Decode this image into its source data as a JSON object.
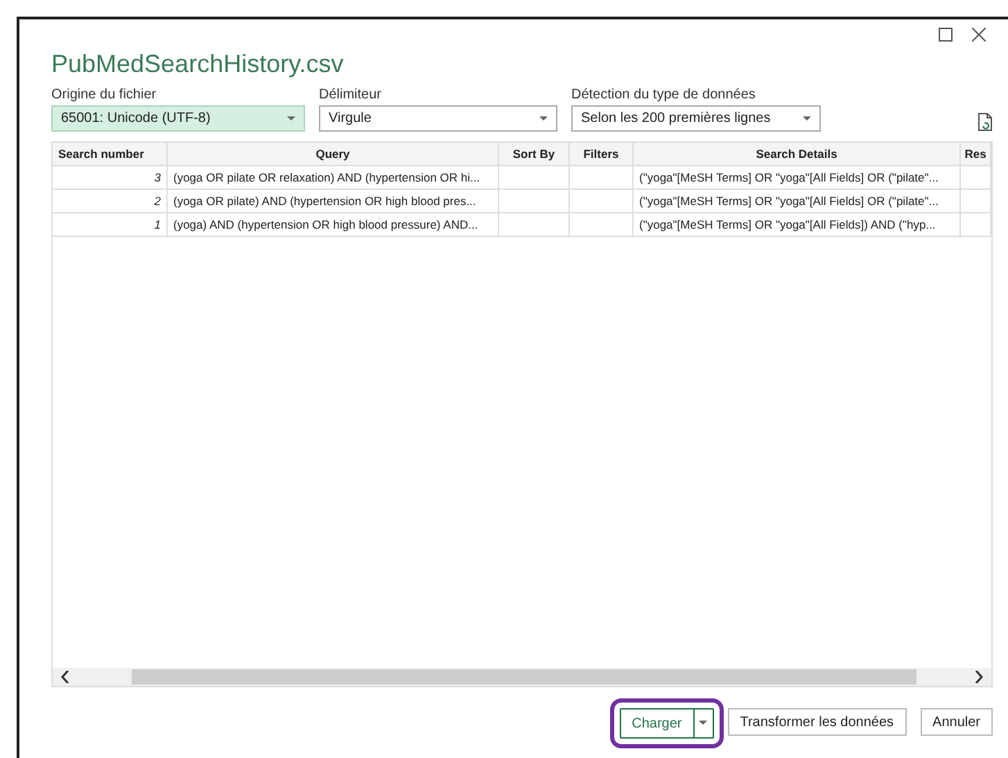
{
  "window": {
    "title": "PubMedSearchHistory.csv"
  },
  "options": [
    {
      "label": "Origine du fichier",
      "value": "65001: Unicode (UTF-8)",
      "highlighted": true
    },
    {
      "label": "Délimiteur",
      "value": "Virgule",
      "highlighted": false
    },
    {
      "label": "Détection du type de données",
      "value": "Selon les 200 premières lignes",
      "highlighted": false
    }
  ],
  "table": {
    "columns": [
      "Search number",
      "Query",
      "Sort By",
      "Filters",
      "Search Details",
      "Res"
    ],
    "rows": [
      [
        "3",
        "(yoga OR pilate OR relaxation) AND (hypertension OR hi...",
        "",
        "",
        "(\"yoga\"[MeSH Terms] OR \"yoga\"[All Fields] OR (\"pilate\"...",
        ""
      ],
      [
        "2",
        "(yoga OR pilate) AND (hypertension OR high blood pres...",
        "",
        "",
        "(\"yoga\"[MeSH Terms] OR \"yoga\"[All Fields] OR (\"pilate\"...",
        ""
      ],
      [
        "1",
        "(yoga) AND (hypertension OR high blood pressure) AND...",
        "",
        "",
        "(\"yoga\"[MeSH Terms] OR \"yoga\"[All Fields]) AND (\"hyp...",
        ""
      ]
    ]
  },
  "buttons": [
    {
      "label": "Charger",
      "kind": "split",
      "highlighted": true
    },
    {
      "label": "Transformer les données",
      "kind": "plain",
      "highlighted": false
    },
    {
      "label": "Annuler",
      "kind": "plain",
      "highlighted": false
    }
  ]
}
